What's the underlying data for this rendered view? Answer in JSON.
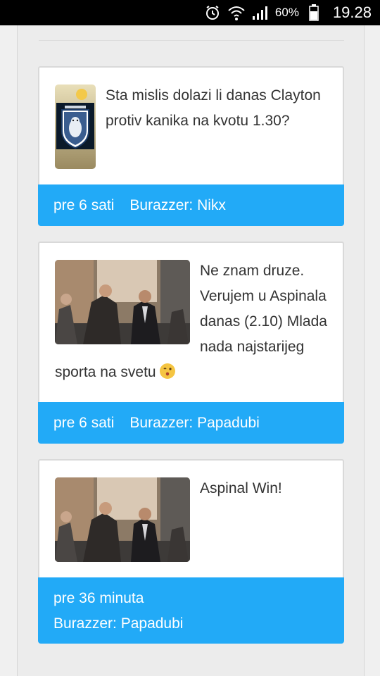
{
  "status_bar": {
    "battery_percent": "60%",
    "time": "19.28",
    "icons": [
      "alarm-icon",
      "wifi-icon",
      "signal-icon",
      "battery-icon"
    ]
  },
  "posts": [
    {
      "avatar": "club-crest-avatar",
      "message": "Sta mislis dolazi li danas Clayton protiv kanika na kvotu 1.30?",
      "time_ago": "pre 6 sati",
      "author": "Burazzer: Nikx"
    },
    {
      "avatar": "street-photo-avatar",
      "message": "Ne znam druze. Verujem u Aspinala danas (2.10) Mlada nada najstarijeg sporta na svetu",
      "emoji": "winking-kiss-emoji",
      "time_ago": "pre 6 sati",
      "author": "Burazzer: Papadubi"
    },
    {
      "avatar": "street-photo-avatar",
      "message": "Aspinal Win!",
      "time_ago": "pre 36 minuta",
      "author": "Burazzer: Papadubi"
    }
  ],
  "colors": {
    "footer_bg": "#22aaf7",
    "card_bg": "#ffffff",
    "page_bg": "#ececec"
  }
}
